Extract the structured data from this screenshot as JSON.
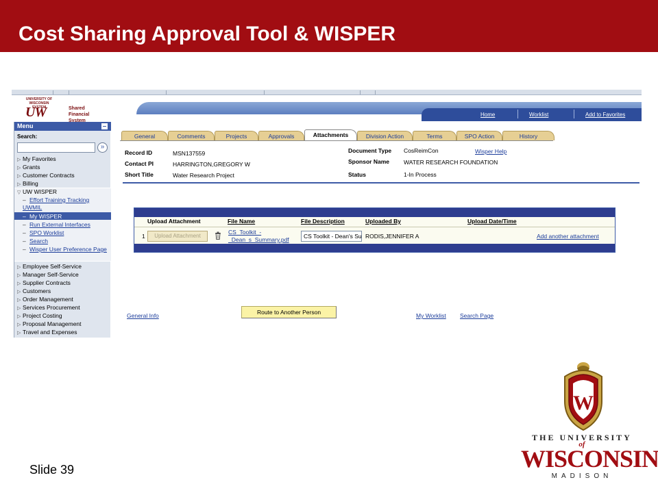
{
  "slide": {
    "title": "Cost Sharing Approval Tool & WISPER",
    "number_label": "Slide 39"
  },
  "banner": {
    "logo_top": "UNIVERSITY OF WISCONSIN SYSTEM",
    "logo_letters": "UW",
    "logo_subtitle": "Shared Financial System",
    "links": [
      "Home",
      "Worklist",
      "Add to Favorites"
    ]
  },
  "menu": {
    "title": "Menu",
    "search_label": "Search:",
    "search_value": "",
    "items_top": [
      "My Favorites",
      "Grants",
      "Customer Contracts",
      "Billing",
      "UW WISPER"
    ],
    "wisper_items": [
      "Effort Training Tracking UWMIL",
      "My WISPER",
      "Run External Interfaces",
      "SPO Worklist",
      "Search",
      "Wisper User Preference Page"
    ],
    "items_bottom": [
      "Employee Self-Service",
      "Manager Self-Service",
      "Supplier Contracts",
      "Customers",
      "Order Management",
      "Services Procurement",
      "Project Costing",
      "Proposal Management",
      "Travel and Expenses"
    ]
  },
  "tabs": [
    "General",
    "Comments",
    "Projects",
    "Approvals",
    "Attachments",
    "Division Action",
    "Terms",
    "SPO Action",
    "History"
  ],
  "record": {
    "record_id_label": "Record ID",
    "record_id": "MSN137559",
    "contact_pi_label": "Contact PI",
    "contact_pi": "HARRINGTON,GREGORY W",
    "short_title_label": "Short Title",
    "short_title": "Water Research Project",
    "doc_type_label": "Document Type",
    "doc_type": "CosReimCon",
    "wisper_help": "Wisper Help",
    "sponsor_label": "Sponsor Name",
    "sponsor": "WATER RESEARCH FOUNDATION",
    "status_label": "Status",
    "status": "1-In Process"
  },
  "attachments": {
    "headers": [
      "Upload Attachment",
      "File Name",
      "File Description",
      "Uploaded By",
      "Upload Date/Time"
    ],
    "row": {
      "index": "1",
      "upload_button": "Upload Attachment",
      "file_name_line1": "CS_Toolkit_-",
      "file_name_line2": "_Dean_s_Summary.pdf",
      "file_description": "CS Toolkit - Dean's Summary",
      "uploaded_by": "RODIS,JENNIFER A",
      "upload_datetime": "",
      "add_link": "Add another attachment"
    }
  },
  "actions": {
    "general_info": "General Info",
    "route_button": "Route to Another Person",
    "my_worklist": "My Worklist",
    "search_page": "Search Page"
  },
  "logo": {
    "line1": "THE UNIVERSITY",
    "of": "of",
    "line2": "WISCONSIN",
    "line3": "MADISON",
    "crest_letter": "W"
  },
  "colors": {
    "header_red": "#a10d12",
    "menu_blue": "#3c5aa6",
    "grid_navy": "#2e3d8f",
    "tab_tan": "#e6cf94",
    "button_yellow": "#fbf3a6"
  }
}
